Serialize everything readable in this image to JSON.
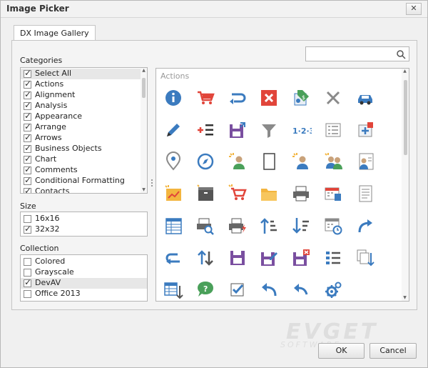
{
  "window": {
    "title": "Image Picker",
    "close_label": "✕"
  },
  "tab": {
    "label": "DX Image Gallery"
  },
  "categories": {
    "label": "Categories",
    "items": [
      {
        "label": "Select All",
        "checked": true,
        "selected": true
      },
      {
        "label": "Actions",
        "checked": true
      },
      {
        "label": "Alignment",
        "checked": true
      },
      {
        "label": "Analysis",
        "checked": true
      },
      {
        "label": "Appearance",
        "checked": true
      },
      {
        "label": "Arrange",
        "checked": true
      },
      {
        "label": "Arrows",
        "checked": true
      },
      {
        "label": "Business Objects",
        "checked": true
      },
      {
        "label": "Chart",
        "checked": true
      },
      {
        "label": "Comments",
        "checked": true
      },
      {
        "label": "Conditional Formatting",
        "checked": true
      },
      {
        "label": "Contacts",
        "checked": true
      }
    ]
  },
  "size": {
    "label": "Size",
    "items": [
      {
        "label": "16x16",
        "checked": false
      },
      {
        "label": "32x32",
        "checked": true
      }
    ]
  },
  "collection": {
    "label": "Collection",
    "items": [
      {
        "label": "Colored",
        "checked": false
      },
      {
        "label": "Grayscale",
        "checked": false
      },
      {
        "label": "DevAV",
        "checked": true,
        "selected": true
      },
      {
        "label": "Office 2013",
        "checked": false
      }
    ]
  },
  "search": {
    "value": "",
    "placeholder": ""
  },
  "gallery": {
    "group_label": "Actions",
    "icons": [
      "info-icon",
      "shopping-cart-icon",
      "redo-arrow-icon",
      "delete-x-icon",
      "price-tag-icon",
      "close-icon",
      "car-icon",
      "pencil-icon",
      "add-list-icon",
      "save-as-icon",
      "filter-icon",
      "numbering-icon",
      "list-icon",
      "add-item-icon",
      "map-pin-icon",
      "compass-icon",
      "new-employee-icon",
      "blank-page-icon",
      "new-contact-icon",
      "customer-group-icon",
      "contact-card-icon",
      "new-chart-icon",
      "new-box-icon",
      "new-cart-icon",
      "folder-icon",
      "printer-icon",
      "delete-calendar-icon",
      "document-icon",
      "table-icon",
      "print-preview-icon",
      "print-flash-icon",
      "sort-up-icon",
      "sort-down-icon",
      "calendar-clock-icon",
      "forward-icon",
      "undo-icon",
      "swap-icon",
      "save-icon",
      "save-edit-icon",
      "save-close-icon",
      "bullet-list-icon",
      "copy-down-icon",
      "table-down-icon",
      "help-chat-icon",
      "checkbox-icon",
      "back-arrow-icon",
      "undo-curve-icon",
      "settings-gear-icon"
    ]
  },
  "buttons": {
    "ok": "OK",
    "cancel": "Cancel"
  },
  "watermark": {
    "text": "EVGET",
    "sub": "SOFTWARE"
  },
  "colors": {
    "blue": "#3b7bbf",
    "red": "#e1453a",
    "purple": "#7a4fa0",
    "green": "#4aa05a",
    "gray": "#8a8a8a",
    "yellow": "#f3b53f"
  }
}
